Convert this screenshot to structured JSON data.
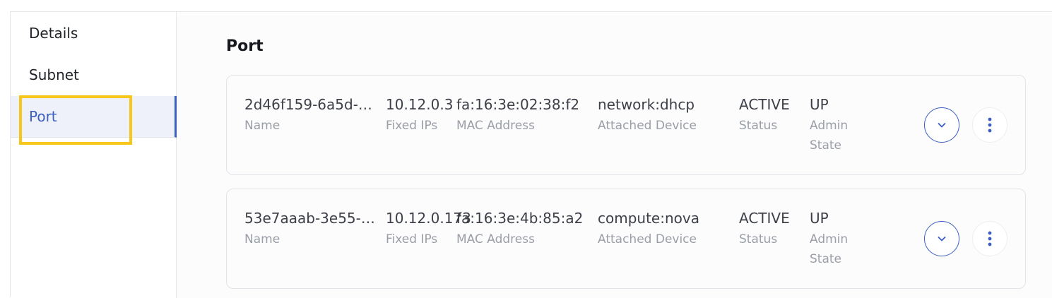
{
  "sidebar": {
    "items": [
      {
        "label": "Details"
      },
      {
        "label": "Subnet"
      },
      {
        "label": "Port"
      }
    ],
    "active": "Port"
  },
  "main": {
    "title": "Port",
    "labels": {
      "name": "Name",
      "fixed_ips": "Fixed IPs",
      "mac": "MAC Address",
      "device": "Attached Device",
      "status": "Status",
      "admin_state": "Admin State"
    },
    "ports": [
      {
        "name": "2d46f159-6a5d-…",
        "fixed_ips": "10.12.0.3",
        "mac": "fa:16:3e:02:38:f2",
        "device": "network:dhcp",
        "status": "ACTIVE",
        "admin_state": "UP"
      },
      {
        "name": "53e7aaab-3e55-…",
        "fixed_ips": "10.12.0.173",
        "mac": "fa:16:3e:4b:85:a2",
        "device": "compute:nova",
        "status": "ACTIVE",
        "admin_state": "UP"
      }
    ]
  },
  "icons": {
    "expand": "chevron-down-icon",
    "more": "more-vertical-icon"
  },
  "colors": {
    "accent": "#3a5fbf",
    "highlight": "#f6c619"
  }
}
